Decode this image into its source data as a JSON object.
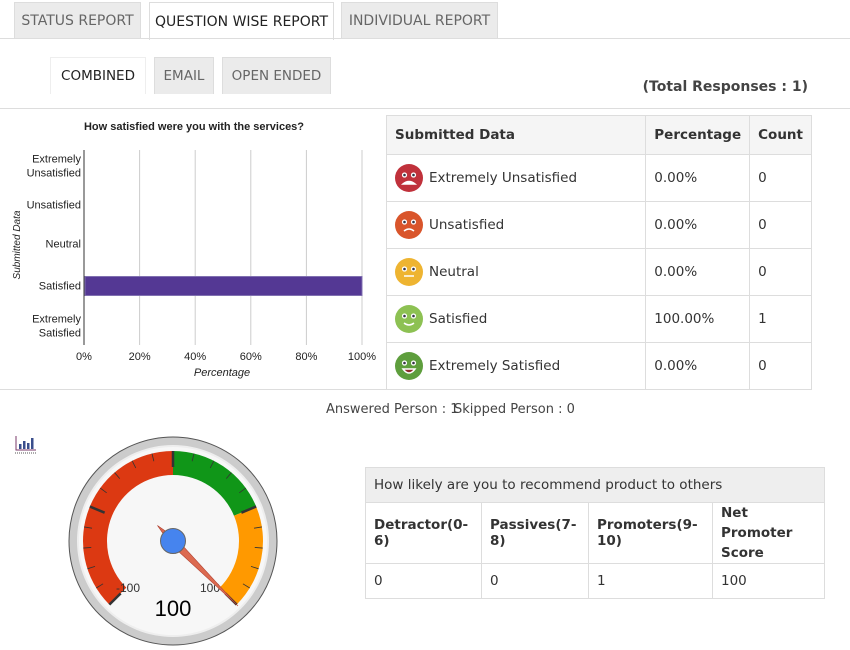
{
  "tabs": [
    {
      "label": "STATUS REPORT"
    },
    {
      "label": "QUESTION WISE REPORT"
    },
    {
      "label": "INDIVIDUAL REPORT"
    }
  ],
  "subtabs": [
    {
      "label": "COMBINED"
    },
    {
      "label": "EMAIL"
    },
    {
      "label": "OPEN ENDED"
    }
  ],
  "total_responses": "(Total Responses : 1)",
  "chart_data": {
    "type": "bar",
    "orientation": "horizontal",
    "title": "How satisfied were you with the services?",
    "xlabel": "Percentage",
    "ylabel": "Submitted Data",
    "categories": [
      "Extremely Unsatisfied",
      "Unsatisfied",
      "Neutral",
      "Satisfied",
      "Extremely Satisfied"
    ],
    "category_lines": [
      [
        "Extremely",
        "Unsatisfied"
      ],
      [
        "Unsatisfied"
      ],
      [
        "Neutral"
      ],
      [
        "Satisfied"
      ],
      [
        "Extremely",
        "Satisfied"
      ]
    ],
    "values": [
      0,
      0,
      0,
      100,
      0
    ],
    "xlim": [
      0,
      100
    ],
    "xticks": [
      "0%",
      "20%",
      "40%",
      "60%",
      "80%",
      "100%"
    ],
    "grid": true,
    "bar_color": "#543894"
  },
  "table": {
    "headers": [
      "Submitted Data",
      "Percentage",
      "Count"
    ],
    "rows": [
      {
        "label": "Extremely Unsatisfied",
        "pct": "0.00%",
        "count": "0",
        "icon": "extremely-unsatisfied-face-icon",
        "color": "#c0313b"
      },
      {
        "label": "Unsatisfied",
        "pct": "0.00%",
        "count": "0",
        "icon": "unsatisfied-face-icon",
        "color": "#d9552b"
      },
      {
        "label": "Neutral",
        "pct": "0.00%",
        "count": "0",
        "icon": "neutral-face-icon",
        "color": "#eeb431"
      },
      {
        "label": "Satisfied",
        "pct": "100.00%",
        "count": "1",
        "icon": "satisfied-face-icon",
        "color": "#8dc153"
      },
      {
        "label": "Extremely Satisfied",
        "pct": "0.00%",
        "count": "0",
        "icon": "extremely-satisfied-face-icon",
        "color": "#5e9e3d"
      }
    ]
  },
  "answered": "Answered Person : 1",
  "skipped": "Skipped Person : 0",
  "gauge": {
    "value": 100,
    "value_text": "100",
    "min": -100,
    "max": 100,
    "min_label": "-100",
    "max_label": "100",
    "bands": [
      {
        "from": -100,
        "to": 0,
        "color": "#dc3912"
      },
      {
        "from": 0,
        "to": 50,
        "color": "#109618"
      },
      {
        "from": 50,
        "to": 100,
        "color": "#ff9900"
      }
    ]
  },
  "nps": {
    "question": "How likely are you to recommend product to others",
    "headers": [
      "Detractor(0-6)",
      "Passives(7-8)",
      "Promoters(9-10)",
      "Net Promoter Score"
    ],
    "values": [
      "0",
      "0",
      "1",
      "100"
    ]
  }
}
